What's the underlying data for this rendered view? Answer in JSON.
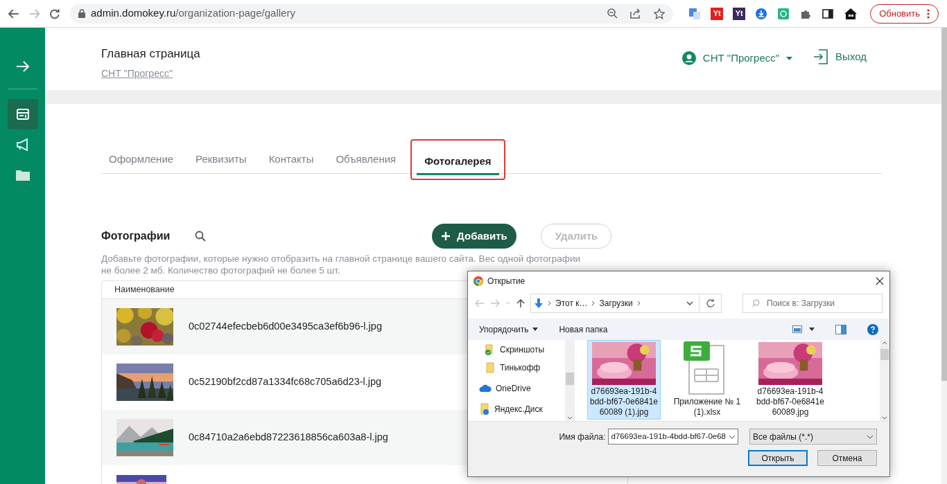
{
  "browser": {
    "url_host": "admin.domokey.ru",
    "url_path": "/organization-page/gallery",
    "extensions": [
      {
        "kind": "translate"
      },
      {
        "kind": "text",
        "label": "Yt",
        "color": "#e32020"
      },
      {
        "kind": "text",
        "label": "Yt",
        "color": "#3c2a5c"
      },
      {
        "kind": "download"
      },
      {
        "kind": "sync"
      },
      {
        "kind": "puzzle"
      },
      {
        "kind": "panel"
      },
      {
        "kind": "house"
      }
    ],
    "update_button": "Обновить"
  },
  "sidebar": {
    "items": [
      {
        "kind": "layout",
        "selected": true
      },
      {
        "kind": "megaphone",
        "selected": false
      },
      {
        "kind": "folder",
        "selected": false
      }
    ]
  },
  "header": {
    "title": "Главная страница",
    "subtitle": "СНТ \"Прогресс\"",
    "account": "СНТ \"Прогресс\"",
    "logout": "Выход"
  },
  "tabs": [
    {
      "label": "Оформление",
      "selected": false,
      "highlighted": false
    },
    {
      "label": "Реквизиты",
      "selected": false,
      "highlighted": false
    },
    {
      "label": "Контакты",
      "selected": false,
      "highlighted": false
    },
    {
      "label": "Объявления",
      "selected": false,
      "highlighted": false
    },
    {
      "label": "Фотогалерея",
      "selected": true,
      "highlighted": true
    }
  ],
  "photos": {
    "title": "Фотографии",
    "add_button": {
      "label": "Добавить",
      "disabled": false
    },
    "delete_button": {
      "label": "Удалить",
      "disabled": true
    },
    "description": "Добавьте фотографии, которые нужно отобразить на главной странице вашего сайта. Вес одной фотографии не более 2 мб. Количество фотографий не более 5 шт.",
    "table": {
      "columns": [
        "Наименование"
      ],
      "rows": [
        {
          "kind": "picture",
          "name": "0c02744efecbeb6d00e3495ca3ef6b96-l.jpg"
        },
        {
          "kind": "picture",
          "name": "0c52190bf2cd87a1334fc68c705a6d23-l.jpg"
        },
        {
          "kind": "picture",
          "name": "0c84710a2a6ebd87223618856ca603a8-l.jpg"
        },
        {
          "kind": "picture"
        }
      ]
    }
  },
  "dialog": {
    "title": "Открытие",
    "path": [
      "Этот к…",
      "Загрузки"
    ],
    "search_placeholder": "Поиск в: Загрузки",
    "toolbar": {
      "organize": "Упорядочить",
      "new_folder": "Новая папка"
    },
    "nav_items": [
      {
        "kind": "synced-folder",
        "label": "Скриншоты"
      },
      {
        "kind": "folder",
        "label": "Тинькофф"
      },
      {
        "kind": "cloud",
        "label": "OneDrive"
      },
      {
        "kind": "drive",
        "label": "Яндекс.Диск"
      }
    ],
    "files": [
      {
        "name": "d76693ea-191b-4bdd-bf67-0e6841e60089 (1).jpg",
        "selected": true
      },
      {
        "kind": "spreadsheet",
        "name": "Приложение № 1 (1).xlsx",
        "selected": false
      },
      {
        "name": "d76693ea-191b-4bdd-bf67-0e6841e60089.jpg",
        "selected": false
      }
    ],
    "filename_label": "Имя файла:",
    "filename_value": "d76693ea-191b-4bdd-bf67-0e68",
    "filter": "Все файлы (*.*)",
    "open_button": "Открыть",
    "cancel_button": "Отмена"
  }
}
